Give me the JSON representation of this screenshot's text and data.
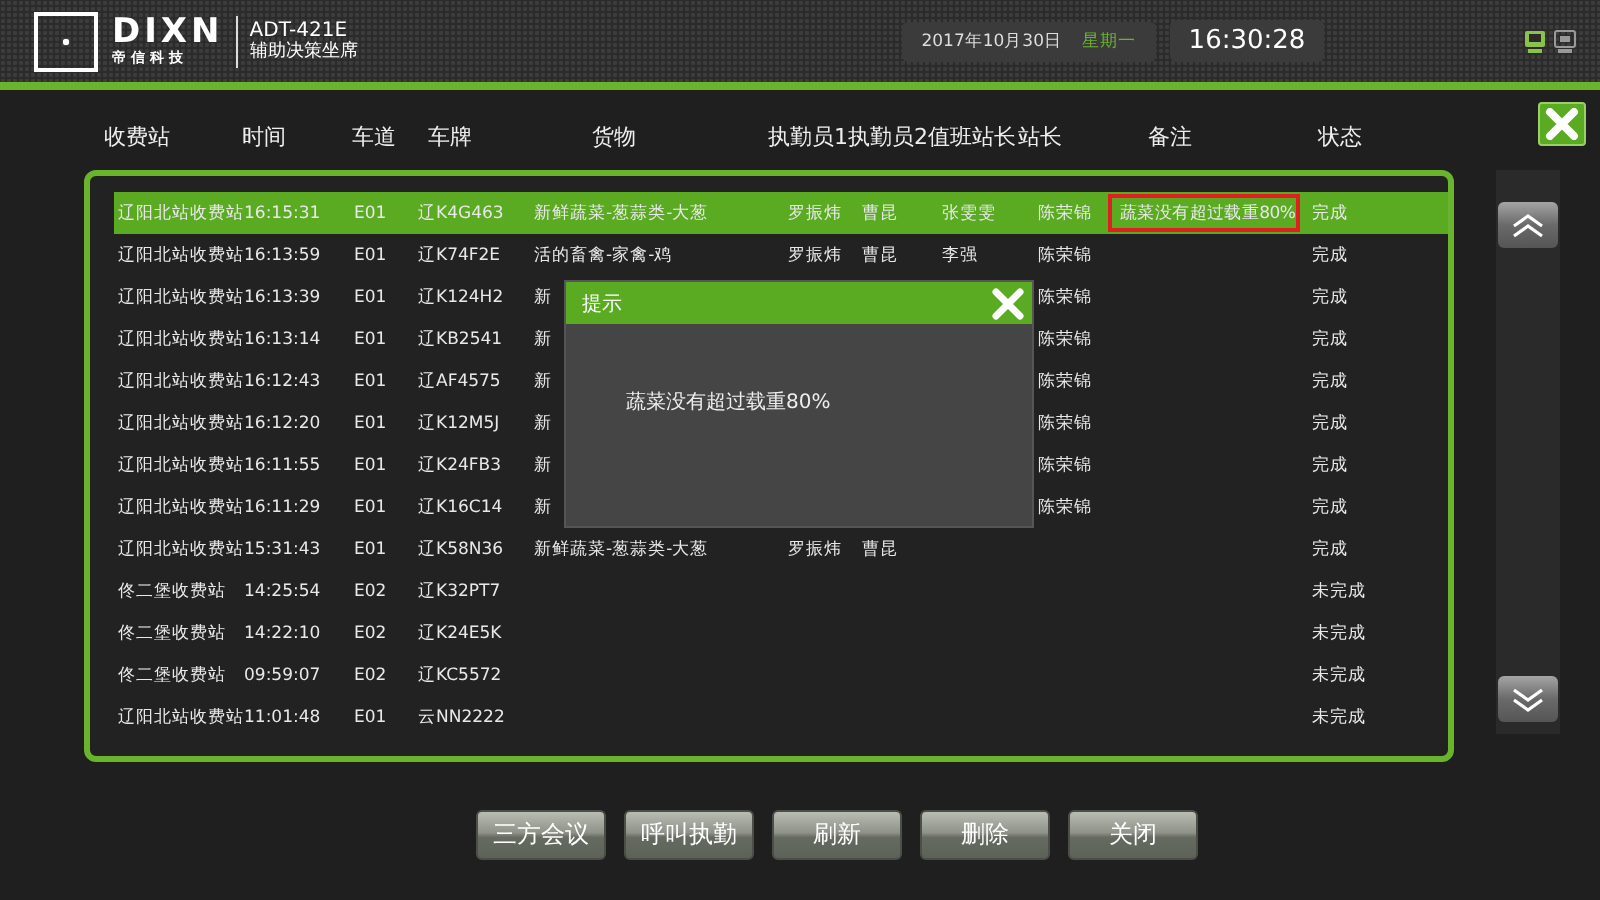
{
  "header": {
    "logo": {
      "brand": "DIXN",
      "brand_sub": "帝 信 科 技"
    },
    "product": {
      "model": "ADT-421E",
      "name": "辅助决策坐席"
    },
    "date": "2017年10月30日",
    "weekday": "星期一",
    "clock": "16:30:28"
  },
  "table": {
    "columns": [
      "收费站",
      "时间",
      "车道",
      "车牌",
      "货物",
      "执勤员1",
      "执勤员2",
      "值班站长",
      "站长",
      "备注",
      "状态"
    ],
    "rows": [
      {
        "station": "辽阳北站收费站",
        "time": "16:15:31",
        "lane": "E01",
        "plate": "辽K4G463",
        "cargo": "新鲜蔬菜-葱蒜类-大葱",
        "officer_1": "罗振炜",
        "officer_2": "曹昆",
        "shift_chief": "张雯雯",
        "chief": "陈荣锦",
        "note": "蔬菜没有超过载重80%",
        "status": "完成",
        "selected": true,
        "note_flagged": true
      },
      {
        "station": "辽阳北站收费站",
        "time": "16:13:59",
        "lane": "E01",
        "plate": "辽K74F2E",
        "cargo": "活的畜禽-家禽-鸡",
        "officer_1": "罗振炜",
        "officer_2": "曹昆",
        "shift_chief": "李强",
        "chief": "陈荣锦",
        "status": "完成",
        "selected": false
      },
      {
        "station": "辽阳北站收费站",
        "time": "16:13:39",
        "lane": "E01",
        "plate": "辽K124H2",
        "cargo": "新",
        "chief": "陈荣锦",
        "status": "完成",
        "selected": false
      },
      {
        "station": "辽阳北站收费站",
        "time": "16:13:14",
        "lane": "E01",
        "plate": "辽KB2541",
        "cargo": "新",
        "chief": "陈荣锦",
        "status": "完成",
        "selected": false
      },
      {
        "station": "辽阳北站收费站",
        "time": "16:12:43",
        "lane": "E01",
        "plate": "辽AF4575",
        "cargo": "新",
        "chief": "陈荣锦",
        "status": "完成",
        "selected": false
      },
      {
        "station": "辽阳北站收费站",
        "time": "16:12:20",
        "lane": "E01",
        "plate": "辽K12M5J",
        "cargo": "新",
        "chief": "陈荣锦",
        "status": "完成",
        "selected": false
      },
      {
        "station": "辽阳北站收费站",
        "time": "16:11:55",
        "lane": "E01",
        "plate": "辽K24FB3",
        "cargo": "新",
        "chief": "陈荣锦",
        "status": "完成",
        "selected": false
      },
      {
        "station": "辽阳北站收费站",
        "time": "16:11:29",
        "lane": "E01",
        "plate": "辽K16C14",
        "cargo": "新",
        "chief": "陈荣锦",
        "status": "完成",
        "selected": false
      },
      {
        "station": "辽阳北站收费站",
        "time": "15:31:43",
        "lane": "E01",
        "plate": "辽K58N36",
        "cargo": "新鲜蔬菜-葱蒜类-大葱",
        "officer_1": "罗振炜",
        "officer_2": "曹昆",
        "status": "完成",
        "selected": false
      },
      {
        "station": "佟二堡收费站",
        "time": "14:25:54",
        "lane": "E02",
        "plate": "辽K32PT7",
        "status": "未完成",
        "selected": false
      },
      {
        "station": "佟二堡收费站",
        "time": "14:22:10",
        "lane": "E02",
        "plate": "辽K24E5K",
        "status": "未完成",
        "selected": false
      },
      {
        "station": "佟二堡收费站",
        "time": "09:59:07",
        "lane": "E02",
        "plate": "辽KC5572",
        "status": "未完成",
        "selected": false
      },
      {
        "station": "辽阳北站收费站",
        "time": "11:01:48",
        "lane": "E01",
        "plate": "云NN2222",
        "status": "未完成",
        "selected": false
      }
    ]
  },
  "dialog": {
    "title": "提示",
    "message": "蔬菜没有超过载重80%"
  },
  "buttons": [
    "三方会议",
    "呼叫执勤",
    "刷新",
    "删除",
    "关闭"
  ]
}
